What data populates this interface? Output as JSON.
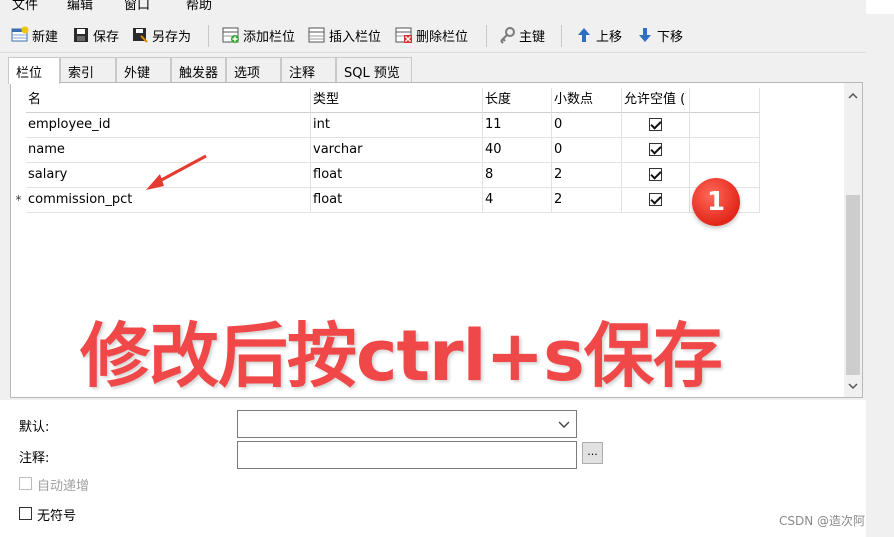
{
  "menu": [
    "文件",
    "编辑",
    "窗口",
    "帮助"
  ],
  "toolbar": {
    "new_label": "新建",
    "save_label": "保存",
    "save_as_label": "另存为",
    "add_column_label": "添加栏位",
    "insert_column_label": "插入栏位",
    "delete_column_label": "删除栏位",
    "primary_key_label": "主键",
    "move_up_label": "上移",
    "move_down_label": "下移"
  },
  "tabs": [
    "栏位",
    "索引",
    "外键",
    "触发器",
    "选项",
    "注释",
    "SQL 预览"
  ],
  "grid": {
    "headers": [
      "名",
      "类型",
      "长度",
      "小数点",
      "允许空值 ("
    ],
    "rows": [
      {
        "indicator": "",
        "name": "employee_id",
        "type": "int",
        "length": "11",
        "decimals": "0",
        "nullable": true
      },
      {
        "indicator": "",
        "name": "name",
        "type": "varchar",
        "length": "40",
        "decimals": "0",
        "nullable": true
      },
      {
        "indicator": "",
        "name": "salary",
        "type": "float",
        "length": "8",
        "decimals": "2",
        "nullable": true
      },
      {
        "indicator": "*",
        "name": "commission_pct",
        "type": "float",
        "length": "4",
        "decimals": "2",
        "nullable": true
      }
    ]
  },
  "properties": {
    "default_label": "默认:",
    "default_value": "",
    "comment_label": "注释:",
    "comment_value": "",
    "ellipsis_label": "...",
    "auto_increment_label": "自动递增",
    "unsigned_label": "无符号"
  },
  "annotation": {
    "overlay_text": "修改后按ctrl+s保存",
    "badge_number": "1",
    "color": "#f04848"
  },
  "watermark": "CSDN @造次阿"
}
